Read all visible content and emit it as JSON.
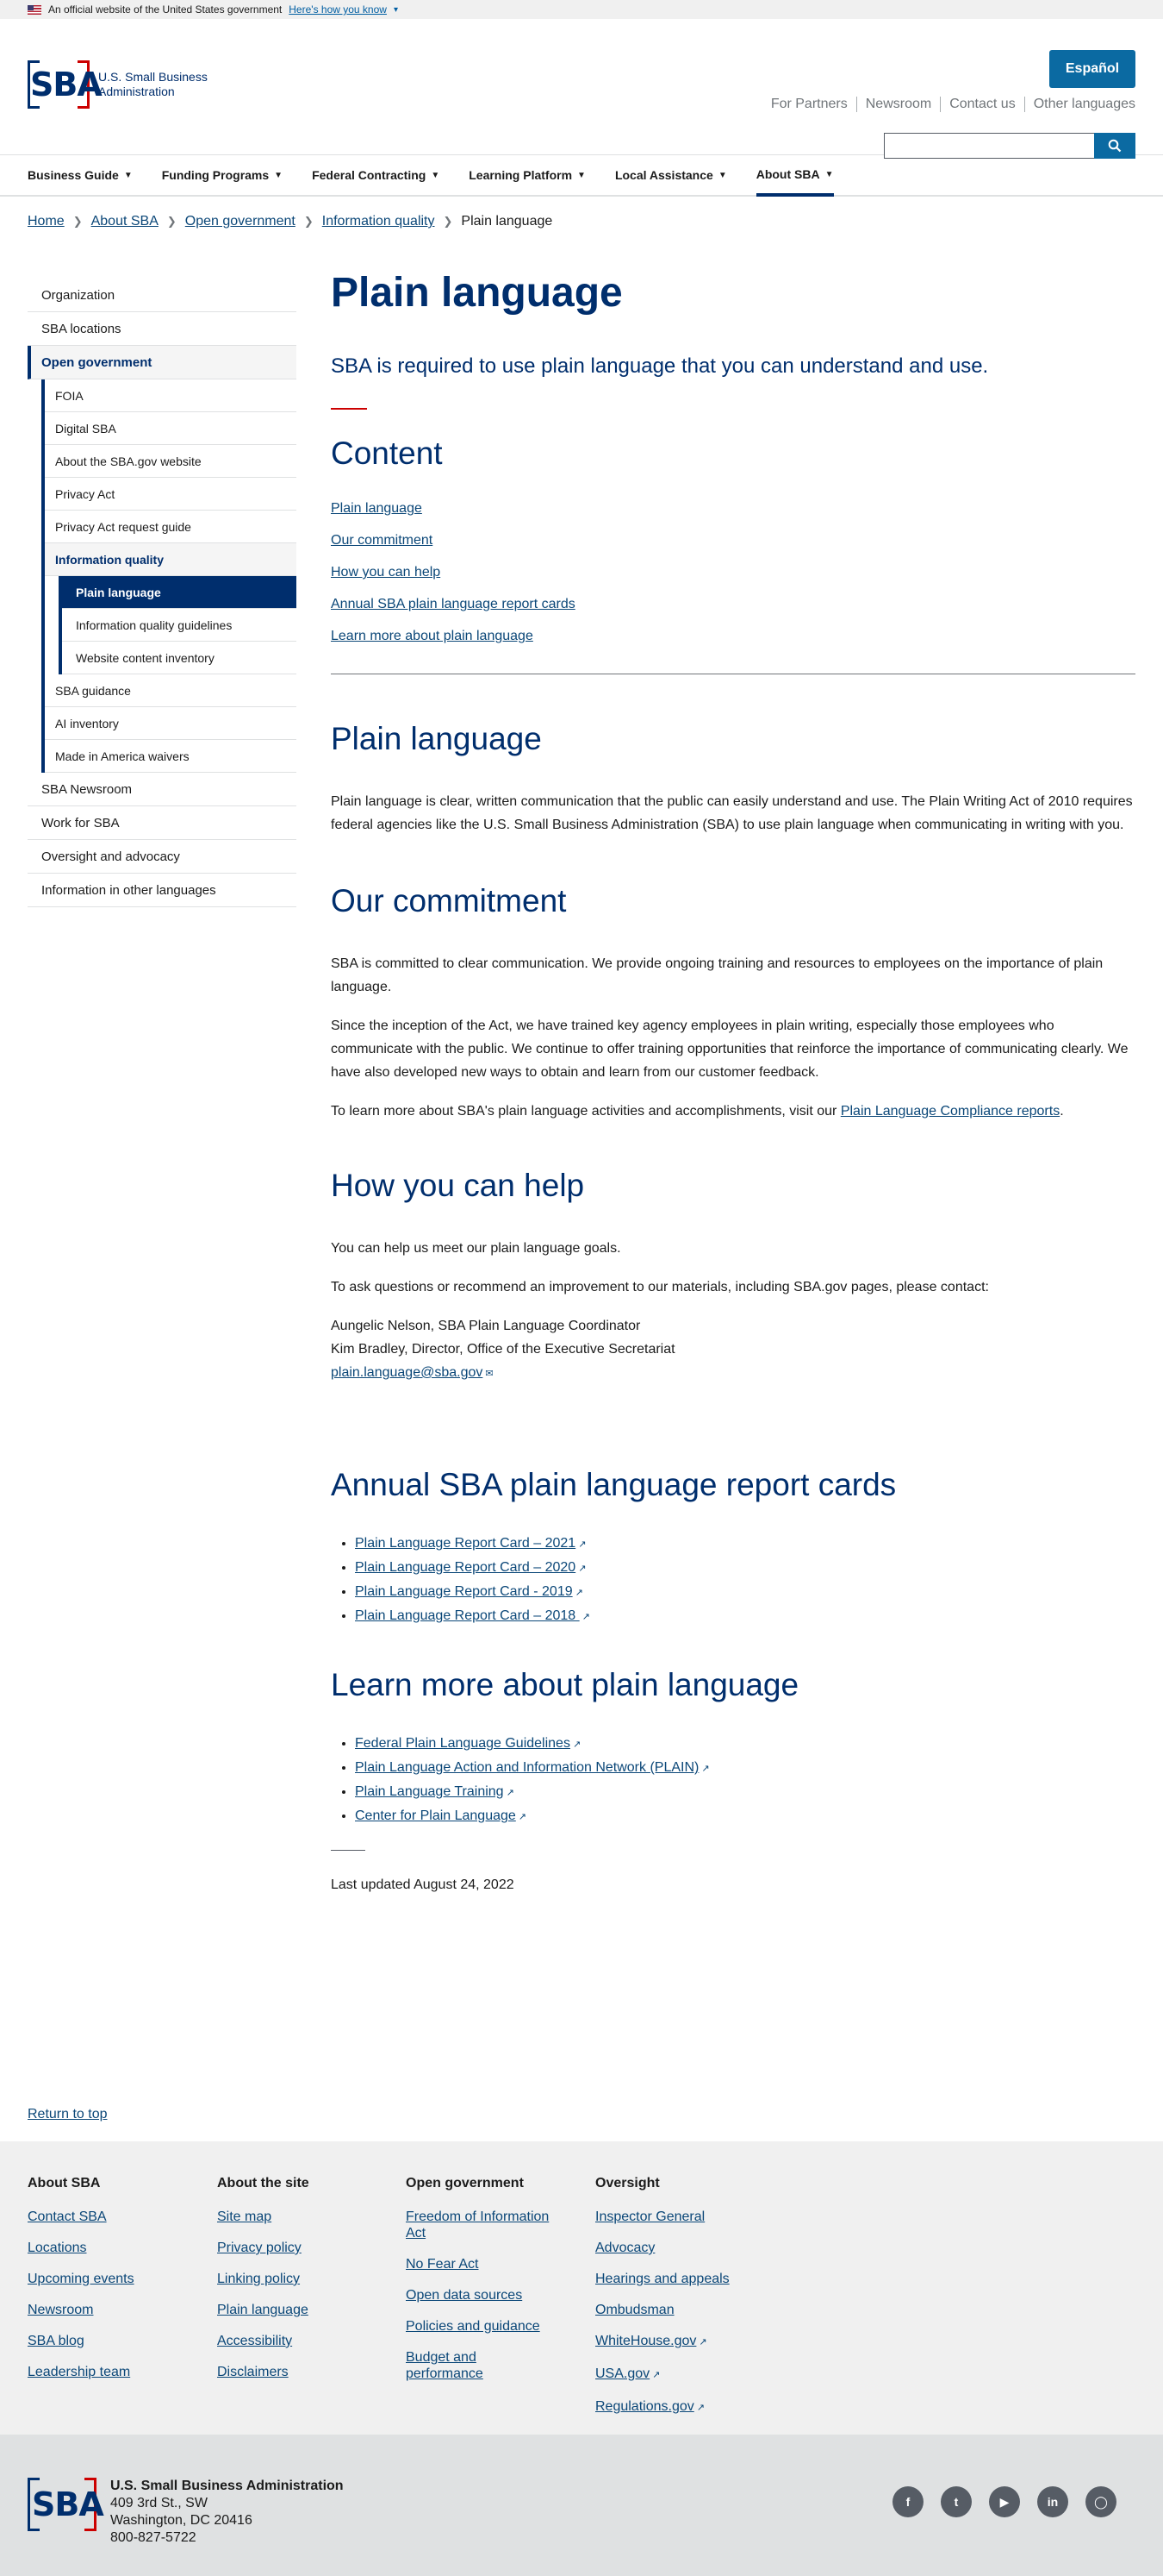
{
  "gov_banner": {
    "text": "An official website of the United States government",
    "link": "Here's how you know"
  },
  "header": {
    "logo_text": "U.S. Small Business Administration",
    "logo_mark": "SBA",
    "espanol": "Español",
    "util_links": [
      "For Partners",
      "Newsroom",
      "Contact us",
      "Other languages"
    ],
    "search_placeholder": ""
  },
  "nav": [
    "Business Guide",
    "Funding Programs",
    "Federal Contracting",
    "Learning Platform",
    "Local Assistance",
    "About SBA"
  ],
  "breadcrumb": [
    "Home",
    "About SBA",
    "Open government",
    "Information quality",
    "Plain language"
  ],
  "sidebar": {
    "top": [
      "Organization",
      "SBA locations",
      "Open government"
    ],
    "open_gov": [
      "FOIA",
      "Digital SBA",
      "About the SBA.gov website",
      "Privacy Act",
      "Privacy Act request guide",
      "Information quality"
    ],
    "info_quality": [
      "Plain language",
      "Information quality guidelines",
      "Website content inventory"
    ],
    "open_gov_after": [
      "SBA guidance",
      "AI inventory",
      "Made in America waivers"
    ],
    "bottom": [
      "SBA Newsroom",
      "Work for SBA",
      "Oversight and advocacy",
      "Information in other languages"
    ]
  },
  "main": {
    "title": "Plain language",
    "intro": "SBA is required to use plain language that you can understand and use.",
    "content_heading": "Content",
    "toc": [
      "Plain language",
      "Our commitment",
      "How you can help",
      "Annual SBA plain language report cards",
      "Learn more about plain language"
    ],
    "s1_heading": "Plain language",
    "s1_p1": "Plain language is clear, written communication that the public can easily understand and use. The Plain Writing Act of 2010 requires federal agencies like the U.S. Small Business Administration (SBA) to use plain language when communicating in writing with you.",
    "s2_heading": "Our commitment",
    "s2_p1": "SBA is committed to clear communication. We provide ongoing training and resources to employees on the importance of plain language.",
    "s2_p2": "Since the inception of the Act, we have trained key agency employees in plain writing, especially those employees who communicate with the public. We continue to offer training opportunities that reinforce the importance of communicating clearly. We have also developed new ways to obtain and learn from our customer feedback.",
    "s2_p3_pre": "To learn more about SBA's plain language activities and accomplishments, visit our ",
    "s2_p3_link": "Plain Language Compliance reports",
    "s2_p3_post": ".",
    "s3_heading": "How you can help",
    "s3_p1": "You can help us meet our plain language goals.",
    "s3_p2": "To ask questions or recommend an improvement to our materials, including SBA.gov pages, please contact:",
    "s3_contact1": "Aungelic Nelson, SBA Plain Language Coordinator",
    "s3_contact2": "Kim Bradley, Director, Office of the Executive Secretariat",
    "s3_email": "plain.language@sba.gov",
    "s4_heading": "Annual SBA plain language report cards",
    "s4_links": [
      "Plain Language Report Card – 2021",
      "Plain Language Report Card – 2020",
      "Plain Language Report Card -  2019",
      "Plain Language Report Card – 2018 "
    ],
    "s5_heading": "Learn more about plain language",
    "s5_links": [
      "Federal Plain Language Guidelines",
      "Plain Language Action and Information Network (PLAIN)",
      "Plain Language Training",
      "Center for Plain Language"
    ],
    "last_updated": "Last updated August 24, 2022"
  },
  "return_top": "Return to top",
  "footer": {
    "cols": [
      {
        "heading": "About SBA",
        "links": [
          "Contact SBA",
          "Locations",
          "Upcoming events",
          "Newsroom",
          "SBA blog",
          "Leadership team"
        ]
      },
      {
        "heading": "About the site",
        "links": [
          "Site map",
          "Privacy policy",
          "Linking policy",
          "Plain language",
          "Accessibility",
          "Disclaimers"
        ]
      },
      {
        "heading": "Open government",
        "links": [
          "Freedom of Information Act",
          "No Fear Act",
          "Open data sources",
          "Policies and guidance",
          "Budget and performance"
        ]
      },
      {
        "heading": "Oversight",
        "links": [
          "Inspector General",
          "Advocacy",
          "Hearings and appeals",
          "Ombudsman",
          "WhiteHouse.gov",
          "USA.gov",
          "Regulations.gov"
        ]
      }
    ],
    "external_flags": [
      [],
      [],
      [],
      [
        false,
        false,
        false,
        false,
        true,
        true,
        true
      ]
    ],
    "org": "U.S. Small Business Administration",
    "address1": "409 3rd St., SW",
    "address2": "Washington, DC 20416",
    "phone": "800-827-5722",
    "social": [
      "facebook-icon",
      "twitter-icon",
      "youtube-icon",
      "linkedin-icon",
      "instagram-icon"
    ]
  },
  "colors": {
    "brand_navy": "#002e6d",
    "brand_red": "#cc0000",
    "link": "#0b4778",
    "button_blue": "#0b6aa2"
  }
}
